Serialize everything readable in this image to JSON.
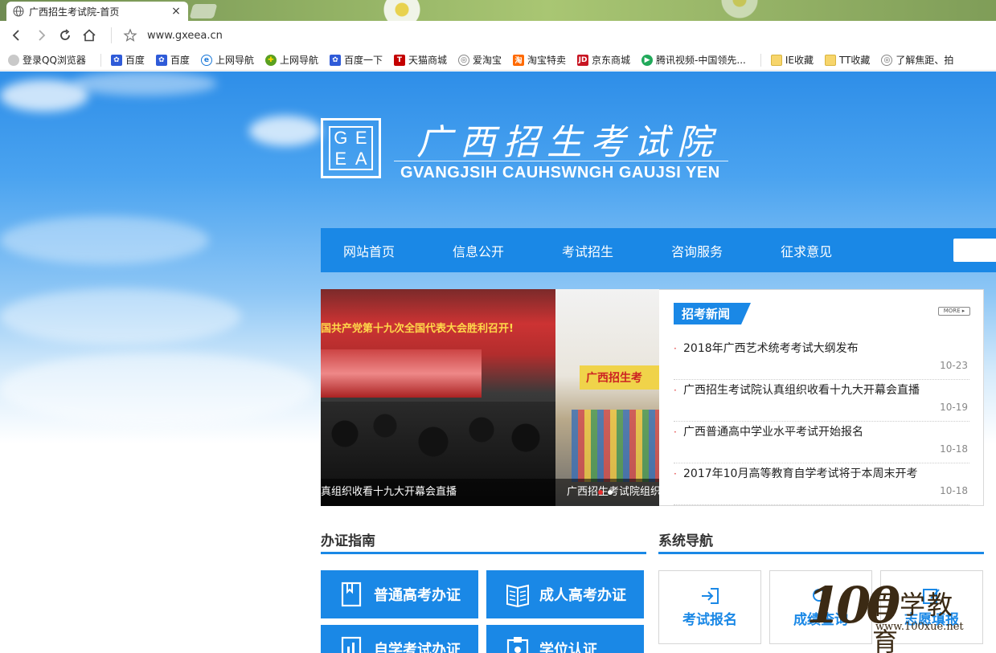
{
  "browser": {
    "tab_title": "广西招生考试院-首页",
    "tab_close": "×",
    "url": "www.gxeea.cn",
    "bookmarks": [
      {
        "label": "登录QQ浏览器",
        "icon": "avatar-icon"
      },
      {
        "label": "百度",
        "icon": "baidu-paw-icon"
      },
      {
        "label": "百度",
        "icon": "baidu-paw-icon"
      },
      {
        "label": "上网导航",
        "icon": "ie-e-icon"
      },
      {
        "label": "上网导航",
        "icon": "hao123-icon"
      },
      {
        "label": "百度一下",
        "icon": "baidu-paw-icon"
      },
      {
        "label": "天猫商城",
        "icon": "tmall-t-icon"
      },
      {
        "label": "爱淘宝",
        "icon": "globe-icon"
      },
      {
        "label": "淘宝特卖",
        "icon": "taobao-icon"
      },
      {
        "label": "京东商城",
        "icon": "jd-icon"
      },
      {
        "label": "腾讯视频-中国领先...",
        "icon": "tencent-video-icon"
      },
      {
        "label": "IE收藏",
        "icon": "folder-icon"
      },
      {
        "label": "TT收藏",
        "icon": "folder-icon"
      },
      {
        "label": "了解焦距、拍",
        "icon": "globe-icon"
      }
    ]
  },
  "header": {
    "logo_letters": [
      "G",
      "E",
      "E",
      "A"
    ],
    "title": "广西招生考试院",
    "subtitle": "GVANGJSIH CAUHSWNGH GAUJSI YEN"
  },
  "nav": {
    "items": [
      "网站首页",
      "信息公开",
      "考试招生",
      "咨询服务",
      "征求意见"
    ]
  },
  "slider": {
    "banner_text": "国共产党第十九次全国代表大会胜利召开!",
    "caption1": "真组织收看十九大开幕会直播",
    "sign_text": "广西招生考",
    "caption2": "广西招生考试院组织"
  },
  "news": {
    "tag": "招考新闻",
    "more": "MORE ▸",
    "items": [
      {
        "title": "2018年广西艺术统考考试大纲发布",
        "date": "10-23"
      },
      {
        "title": "广西招生考试院认真组织收看十九大开幕会直播",
        "date": "10-19"
      },
      {
        "title": "广西普通高中学业水平考试开始报名",
        "date": "10-18"
      },
      {
        "title": "2017年10月高等教育自学考试将于本周末开考",
        "date": "10-18"
      }
    ]
  },
  "guide": {
    "title": "办证指南",
    "buttons": [
      "普通高考办证",
      "成人高考办证",
      "自学考试办证",
      "学位认证"
    ]
  },
  "system": {
    "title": "系统导航",
    "cards": [
      "考试报名",
      "成绩查询",
      "志愿填报"
    ]
  },
  "watermark": {
    "number": "100",
    "text": "百学教育",
    "url": "www.100xue.net"
  },
  "colors": {
    "brand_blue": "#1a88e6",
    "news_bullet": "#e03030"
  }
}
